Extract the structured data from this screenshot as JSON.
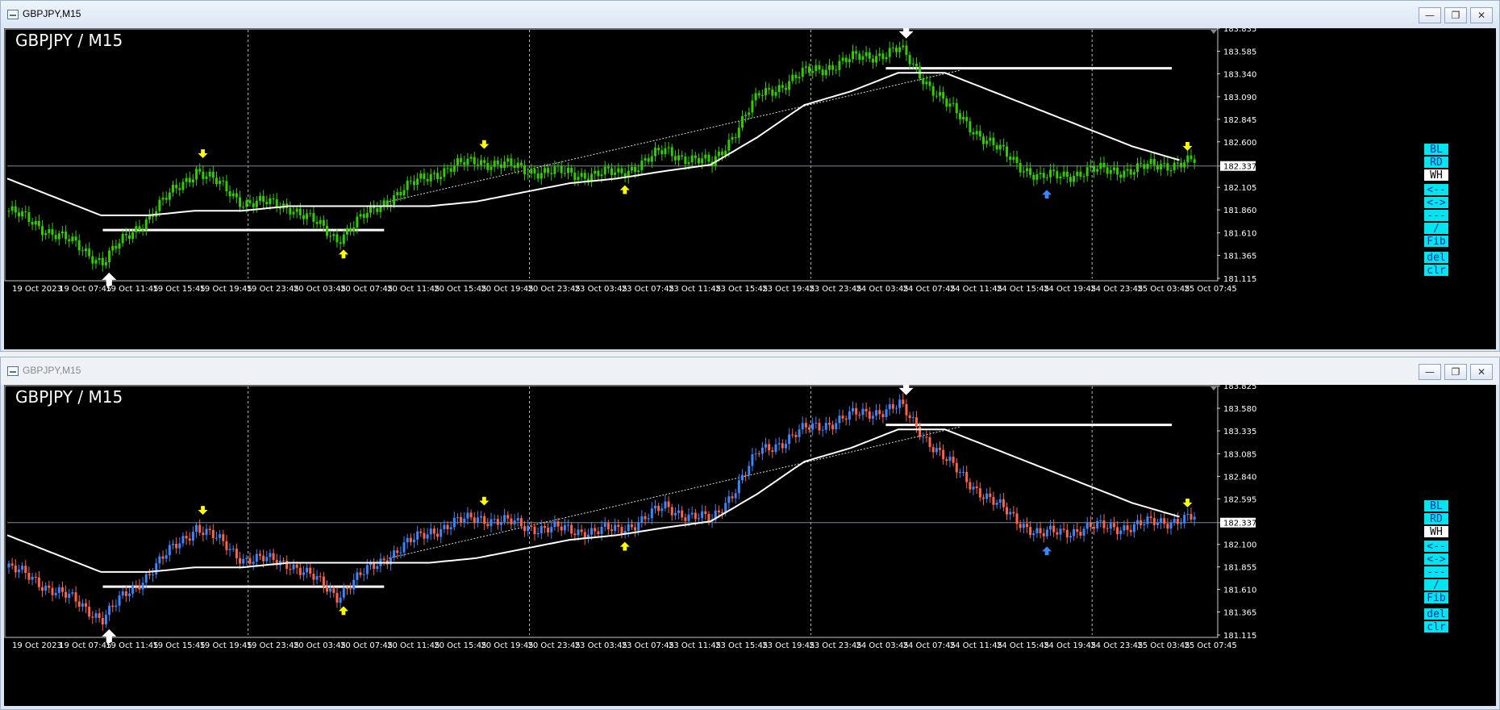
{
  "windows": [
    {
      "title": "GBPJPY,M15",
      "chart_title": "GBPJPY / M15",
      "price_labels": [
        "183.835",
        "183.585",
        "183.340",
        "183.090",
        "182.845",
        "182.600",
        "182.337",
        "182.105",
        "181.860",
        "181.610",
        "181.365",
        "181.115"
      ],
      "current_price": "182.337",
      "candle_colors": {
        "up": "#33cc00",
        "down": "#33cc00"
      }
    },
    {
      "title": "GBPJPY,M15",
      "chart_title": "GBPJPY / M15",
      "price_labels": [
        "183.825",
        "183.580",
        "183.335",
        "183.085",
        "182.840",
        "182.595",
        "182.337",
        "182.100",
        "181.855",
        "181.610",
        "181.365",
        "181.115"
      ],
      "current_price": "182.337",
      "candle_colors": {
        "up": "#3a86ff",
        "down": "#ff6347"
      }
    }
  ],
  "time_labels": [
    "19 Oct 2023",
    "19 Oct 07:45",
    "19 Oct 11:45",
    "19 Oct 15:45",
    "19 Oct 19:45",
    "19 Oct 23:45",
    "20 Oct 03:45",
    "20 Oct 07:45",
    "20 Oct 11:45",
    "20 Oct 15:45",
    "20 Oct 19:45",
    "20 Oct 23:45",
    "23 Oct 03:45",
    "23 Oct 07:45",
    "23 Oct 11:45",
    "23 Oct 15:45",
    "23 Oct 19:45",
    "23 Oct 23:45",
    "24 Oct 03:45",
    "24 Oct 07:45",
    "24 Oct 11:45",
    "24 Oct 15:45",
    "24 Oct 19:45",
    "24 Oct 23:45",
    "25 Oct 03:45",
    "25 Oct 07:45"
  ],
  "object_buttons": [
    "BL",
    "RD",
    "WH",
    "<--",
    "<->",
    "---",
    "/",
    "Fib",
    "del",
    "clr"
  ],
  "window_buttons": {
    "minimize": "—",
    "restore": "❐",
    "close": "✕"
  },
  "chart_data": {
    "type": "line",
    "title": "GBPJPY / M15",
    "x": [
      "19 Oct 2023",
      "19 Oct 07:45",
      "19 Oct 11:45",
      "19 Oct 15:45",
      "19 Oct 19:45",
      "19 Oct 23:45",
      "20 Oct 03:45",
      "20 Oct 07:45",
      "20 Oct 11:45",
      "20 Oct 15:45",
      "20 Oct 19:45",
      "20 Oct 23:45",
      "23 Oct 03:45",
      "23 Oct 07:45",
      "23 Oct 11:45",
      "23 Oct 15:45",
      "23 Oct 19:45",
      "23 Oct 23:45",
      "24 Oct 03:45",
      "24 Oct 07:45",
      "24 Oct 11:45",
      "24 Oct 15:45",
      "24 Oct 19:45",
      "24 Oct 23:45",
      "25 Oct 03:45",
      "25 Oct 07:45"
    ],
    "series": [
      {
        "values": [
          181.85,
          181.6,
          181.3,
          181.8,
          182.3,
          181.95,
          181.9,
          181.55,
          181.95,
          182.25,
          182.4,
          182.3,
          182.25,
          182.25,
          182.5,
          182.35,
          183.1,
          183.35,
          183.5,
          183.6,
          183.0,
          182.55,
          182.2,
          182.28,
          182.3,
          182.38
        ]
      },
      {
        "values": [
          182.2,
          182.0,
          181.8,
          181.8,
          181.85,
          181.85,
          181.9,
          181.9,
          181.9,
          181.9,
          181.95,
          182.05,
          182.15,
          182.2,
          182.28,
          182.35,
          182.65,
          183.0,
          183.15,
          183.35,
          183.35,
          183.15,
          182.95,
          182.75,
          182.55,
          182.4
        ]
      }
    ],
    "ylim": [
      181.115,
      183.835
    ],
    "current_price": 182.337,
    "horizontal_lines": [
      181.64,
      183.4
    ],
    "signals": [
      {
        "x": "19 Oct 11:45",
        "direction": "up",
        "color": "#ffffff"
      },
      {
        "x": "19 Oct 19:45",
        "direction": "down",
        "color": "#ffff00"
      },
      {
        "x": "20 Oct 07:45",
        "direction": "up",
        "color": "#ffff00"
      },
      {
        "x": "20 Oct 19:45",
        "direction": "down",
        "color": "#ffff00"
      },
      {
        "x": "23 Oct 07:45",
        "direction": "up",
        "color": "#ffff00"
      },
      {
        "x": "24 Oct 07:45",
        "direction": "down",
        "color": "#ffffff"
      },
      {
        "x": "24 Oct 19:45",
        "direction": "up",
        "color": "#3a86ff"
      },
      {
        "x": "25 Oct 07:45",
        "direction": "down",
        "color": "#ffff00"
      }
    ],
    "grid": true
  }
}
